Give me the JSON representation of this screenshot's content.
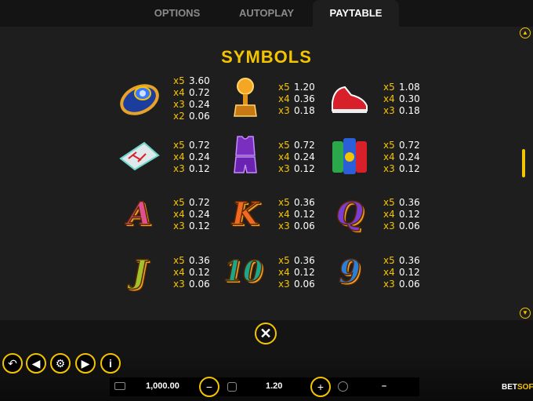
{
  "tabs": [
    {
      "label": "OPTIONS",
      "active": false
    },
    {
      "label": "AUTOPLAY",
      "active": false
    },
    {
      "label": "PAYTABLE",
      "active": true
    }
  ],
  "section_title": "SYMBOLS",
  "symbols": [
    {
      "icon": "championship-ring-icon",
      "pays": [
        {
          "m": "x5",
          "v": "3.60"
        },
        {
          "m": "x4",
          "v": "0.72"
        },
        {
          "m": "x3",
          "v": "0.24"
        },
        {
          "m": "x2",
          "v": "0.06"
        }
      ]
    },
    {
      "icon": "trophy-icon",
      "pays": [
        {
          "m": "x5",
          "v": "1.20"
        },
        {
          "m": "x4",
          "v": "0.36"
        },
        {
          "m": "x3",
          "v": "0.18"
        }
      ]
    },
    {
      "icon": "sneakers-icon",
      "pays": [
        {
          "m": "x5",
          "v": "1.08"
        },
        {
          "m": "x4",
          "v": "0.30"
        },
        {
          "m": "x3",
          "v": "0.18"
        }
      ]
    },
    {
      "icon": "playbook-clipboard-icon",
      "pays": [
        {
          "m": "x5",
          "v": "0.72"
        },
        {
          "m": "x4",
          "v": "0.24"
        },
        {
          "m": "x3",
          "v": "0.12"
        }
      ]
    },
    {
      "icon": "jersey-icon",
      "pays": [
        {
          "m": "x5",
          "v": "0.72"
        },
        {
          "m": "x4",
          "v": "0.24"
        },
        {
          "m": "x3",
          "v": "0.12"
        }
      ]
    },
    {
      "icon": "sports-drinks-icon",
      "pays": [
        {
          "m": "x5",
          "v": "0.72"
        },
        {
          "m": "x4",
          "v": "0.24"
        },
        {
          "m": "x3",
          "v": "0.12"
        }
      ]
    },
    {
      "icon": "letter-a-icon",
      "glyph": "A",
      "color": "#e0508f",
      "pays": [
        {
          "m": "x5",
          "v": "0.72"
        },
        {
          "m": "x4",
          "v": "0.24"
        },
        {
          "m": "x3",
          "v": "0.12"
        }
      ]
    },
    {
      "icon": "letter-k-icon",
      "glyph": "K",
      "color": "#f06a22",
      "pays": [
        {
          "m": "x5",
          "v": "0.36"
        },
        {
          "m": "x4",
          "v": "0.12"
        },
        {
          "m": "x3",
          "v": "0.06"
        }
      ]
    },
    {
      "icon": "letter-q-icon",
      "glyph": "Q",
      "color": "#7a3fd0",
      "pays": [
        {
          "m": "x5",
          "v": "0.36"
        },
        {
          "m": "x4",
          "v": "0.12"
        },
        {
          "m": "x3",
          "v": "0.06"
        }
      ]
    },
    {
      "icon": "letter-j-icon",
      "glyph": "J",
      "color": "#a0c22a",
      "pays": [
        {
          "m": "x5",
          "v": "0.36"
        },
        {
          "m": "x4",
          "v": "0.12"
        },
        {
          "m": "x3",
          "v": "0.06"
        }
      ]
    },
    {
      "icon": "number-10-icon",
      "glyph": "10",
      "color": "#1aa88a",
      "pays": [
        {
          "m": "x5",
          "v": "0.36"
        },
        {
          "m": "x4",
          "v": "0.12"
        },
        {
          "m": "x3",
          "v": "0.06"
        }
      ]
    },
    {
      "icon": "number-9-icon",
      "glyph": "9",
      "color": "#2a7fd8",
      "pays": [
        {
          "m": "x5",
          "v": "0.36"
        },
        {
          "m": "x4",
          "v": "0.12"
        },
        {
          "m": "x3",
          "v": "0.06"
        }
      ]
    }
  ],
  "controls": {
    "balance": "1,000.00",
    "bet": "1.20",
    "win": "–",
    "logo_main": "BET",
    "logo_accent": "SOFT"
  },
  "colors": {
    "accent": "#f5c400",
    "panel": "#1e1e1e"
  }
}
